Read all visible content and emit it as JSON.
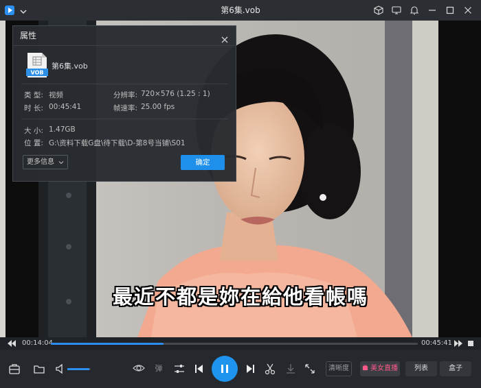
{
  "window": {
    "title": "第6集.vob",
    "colors": {
      "accent": "#1e8fea",
      "titlebar": "#2b2e33",
      "panel": "#282b30"
    }
  },
  "dialog": {
    "title": "属性",
    "file_name": "第6集.vob",
    "file_type_badge": "VOB",
    "type_label": "类 型:",
    "type_value": "视频",
    "resolution_label": "分辨率:",
    "resolution_value": "720×576 (1.25 : 1)",
    "duration_label": "时 长:",
    "duration_value": "00:45:41",
    "framerate_label": "帧速率:",
    "framerate_value": "25.00 fps",
    "size_label": "大 小:",
    "size_value": "1.47GB",
    "location_label": "位 置:",
    "location_value": "G:\\资料下载G盘\\待下载\\D-第8号当铺\\S01",
    "more_info": "更多信息",
    "ok": "确定"
  },
  "video": {
    "subtitle": "最近不都是妳在給他看帳嗎"
  },
  "playback": {
    "current_time": "00:14:04",
    "total_time": "00:45:41",
    "progress": 0.308,
    "volume": 0.95
  },
  "controls": {
    "danmaku_label": "弹",
    "quality_label": "清晰度",
    "live_label": "美女直播",
    "list_label": "列表",
    "box_label": "盒子"
  },
  "icons": [
    "app-logo-icon",
    "chevron-down-icon",
    "cube-icon",
    "screen-icon",
    "bell-icon",
    "minimize-icon",
    "maximize-icon",
    "close-icon"
  ]
}
